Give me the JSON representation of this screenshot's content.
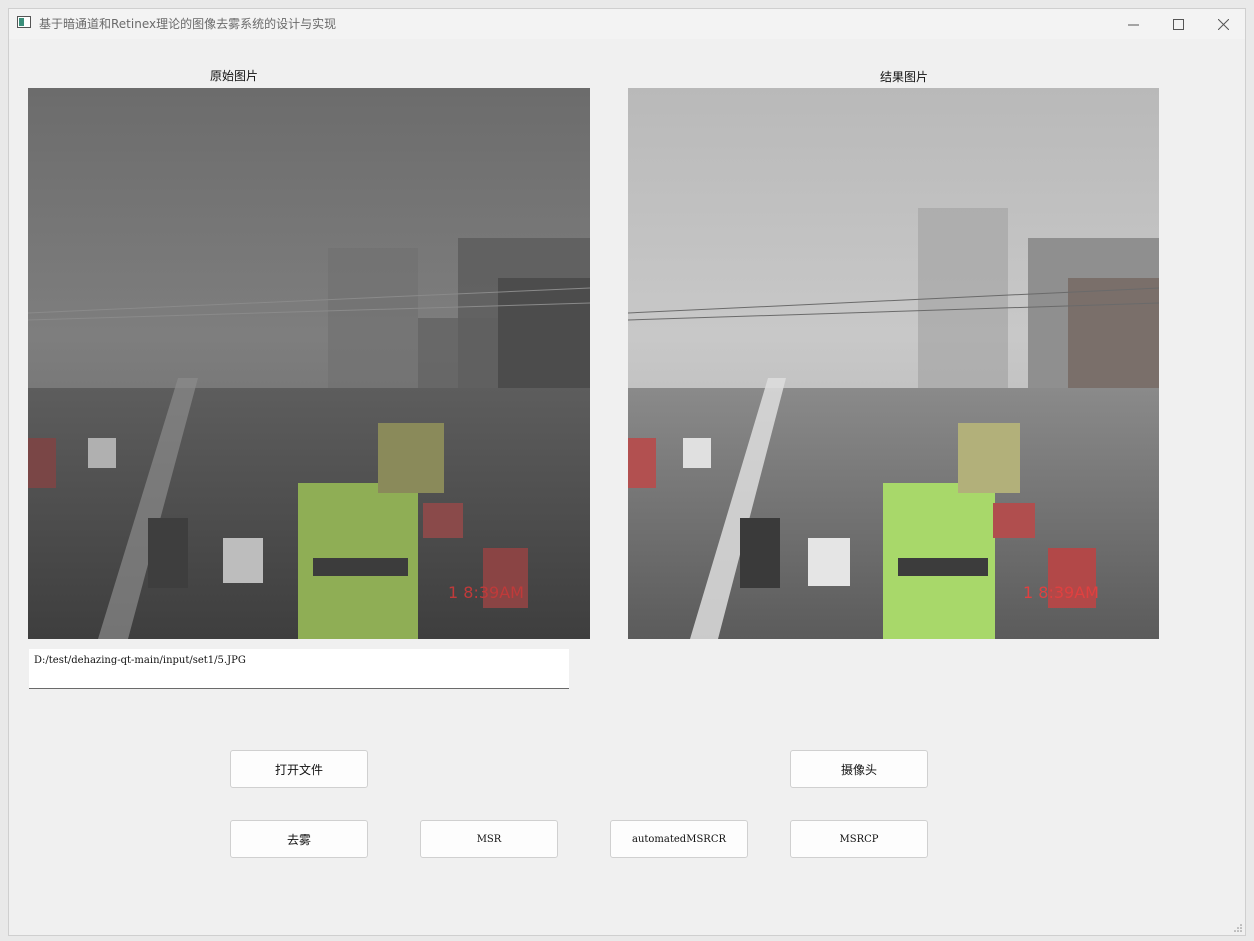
{
  "window": {
    "title": "基于暗通道和Retinex理论的图像去雾系统的设计与实现"
  },
  "controls": {
    "minimize": "—",
    "maximize": "☐",
    "close": "✕"
  },
  "left_panel": {
    "label": "原始图片"
  },
  "right_panel": {
    "label": "结果图片"
  },
  "path_field": {
    "value": "D:/test/dehazing-qt-main/input/set1/5.JPG"
  },
  "buttons": {
    "open_file": "打开文件",
    "camera": "摄像头",
    "dehaze": "去雾",
    "msr": "MSR",
    "automated_msrcr": "automatedMSRCR",
    "msrcp": "MSRCP"
  }
}
